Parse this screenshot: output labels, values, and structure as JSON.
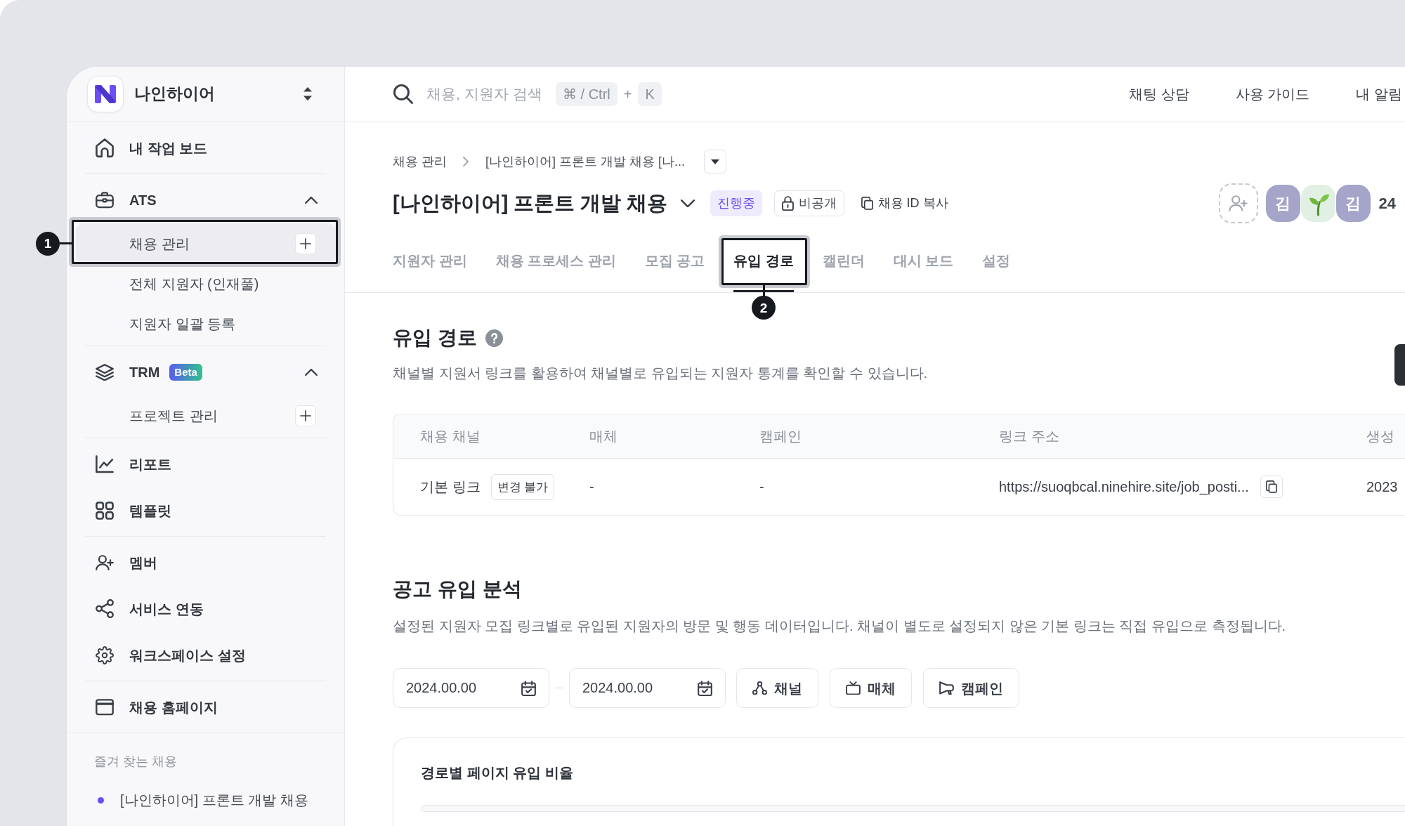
{
  "workspace": {
    "name": "나인하이어"
  },
  "sidebar": {
    "groups": [
      {
        "items": [
          {
            "kind": "link",
            "label": "내 작업 보드",
            "selected": false
          }
        ]
      },
      {
        "items": [
          {
            "kind": "section",
            "label": "ATS",
            "expanded": true,
            "children": [
              {
                "label": "채용 관리",
                "selected": true,
                "add_button": true,
                "callout": "1"
              },
              {
                "label": "전체 지원자 (인재풀)",
                "selected": false,
                "add_button": false
              },
              {
                "label": "지원자 일괄 등록",
                "selected": false,
                "add_button": false
              }
            ]
          }
        ]
      },
      {
        "items": [
          {
            "kind": "section",
            "label": "TRM",
            "badge": "Beta",
            "expanded": true,
            "children": [
              {
                "label": "프로젝트 관리",
                "selected": false,
                "add_button": true
              }
            ]
          }
        ]
      },
      {
        "items": [
          {
            "kind": "link",
            "label": "리포트",
            "selected": false
          },
          {
            "kind": "link",
            "label": "템플릿",
            "selected": false
          }
        ]
      },
      {
        "items": [
          {
            "kind": "link",
            "label": "멤버",
            "selected": false
          },
          {
            "kind": "link",
            "label": "서비스 연동",
            "selected": false
          },
          {
            "kind": "link",
            "label": "워크스페이스 설정",
            "selected": false
          }
        ]
      },
      {
        "items": [
          {
            "kind": "link",
            "label": "채용 홈페이지",
            "selected": false
          }
        ]
      }
    ],
    "favorites": {
      "title": "즐겨 찾는 채용",
      "items": [
        {
          "label": "[나인하이어] 프론트 개발 채용",
          "color": "#6a4df4"
        }
      ]
    }
  },
  "topbar": {
    "search": {
      "placeholder": "채용, 지원자 검색",
      "shortcut_keys": [
        "⌘ / Ctrl",
        "K"
      ],
      "shortcut_joiner": "+"
    },
    "links": [
      "채팅 상담",
      "사용 가이드",
      "내 알림"
    ]
  },
  "header": {
    "breadcrumb": [
      "채용 관리",
      "[나인하이어] 프론트 개발 채용 [나..."
    ],
    "title": "[나인하이어] 프론트 개발 채용",
    "status": "진행중",
    "visibility": "비공개",
    "copy_id": "채용 ID 복사",
    "members": [
      {
        "kind": "initial",
        "text": "김"
      },
      {
        "kind": "emoji"
      },
      {
        "kind": "initial",
        "text": "김"
      }
    ],
    "member_count": "24"
  },
  "tabs": [
    {
      "label": "지원자 관리",
      "selected": false
    },
    {
      "label": "채용 프로세스 관리",
      "selected": false
    },
    {
      "label": "모집 공고",
      "selected": false
    },
    {
      "label": "유입 경로",
      "selected": true,
      "callout": "2"
    },
    {
      "label": "캘린더",
      "selected": false
    },
    {
      "label": "대시 보드",
      "selected": false
    },
    {
      "label": "설정",
      "selected": false
    }
  ],
  "inflow": {
    "title": "유입 경로",
    "description": "채널별 지원서 링크를 활용하여 채널별로 유입되는 지원자 통계를 확인할 수 있습니다.",
    "table": {
      "columns": [
        "채용 채널",
        "매체",
        "캠페인",
        "링크 주소",
        "생성"
      ],
      "rows": [
        {
          "cells": [
            {
              "kind": "tagged",
              "text": "기본 링크",
              "tag": "변경 불가"
            },
            {
              "kind": "plain",
              "text": "-"
            },
            {
              "kind": "plain",
              "text": "-"
            },
            {
              "kind": "link",
              "text": "https://suoqbcal.ninehire.site/job_posti..."
            },
            {
              "kind": "plain",
              "text": "2023"
            }
          ]
        }
      ]
    }
  },
  "analysis": {
    "title": "공고 유입 분석",
    "description": "설정된 지원자 모집 링크별로 유입된 지원자의 방문 및 행동 데이터입니다. 채널이 별도로 설정되지 않은 기본 링크는 직접 유입으로 측정됩니다.",
    "date_from": "2024.00.00",
    "date_to": "2024.00.00",
    "filters": [
      "채널",
      "매체",
      "캠페인"
    ],
    "card": {
      "title": "경로별 페이지 유입 비율"
    }
  }
}
